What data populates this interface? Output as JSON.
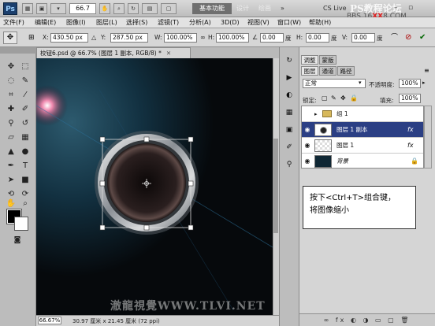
{
  "titlebar": {
    "ps_logo": "Ps",
    "zoom": "66.7",
    "workspace_active": "基本功能",
    "workspace_links": [
      "设计",
      "绘画"
    ],
    "cs_live": "CS Live",
    "watermark_top": "PS教程论坛",
    "watermark_top_url_pre": "BBS.16",
    "watermark_top_url_xx": "XX",
    "watermark_top_url_post": "8.COM"
  },
  "menu": [
    "文件(F)",
    "编辑(E)",
    "图像(I)",
    "图层(L)",
    "选择(S)",
    "滤镜(T)",
    "分析(A)",
    "3D(D)",
    "视图(V)",
    "窗口(W)",
    "帮助(H)"
  ],
  "options": {
    "x_label": "X:",
    "x_value": "430.50 px",
    "y_label": "Y:",
    "y_value": "287.50 px",
    "w_label": "W:",
    "w_value": "100.00%",
    "h_label": "H:",
    "h_value": "100.00%",
    "angle_value": "0.00",
    "angle_unit": "度",
    "h_skew_label": "H:",
    "h_skew_value": "0.00",
    "h_skew_unit": "度",
    "v_label": "V:",
    "v_value": "0.00",
    "v_unit": "度"
  },
  "document": {
    "tab_title": "校钮6.psd @ 66.7% (图层 1 副本, RGB/8) *",
    "status_zoom": "66.67%",
    "status_info": "30.97 厘米 x 21.45 厘米 (72 ppi)"
  },
  "watermark_bottom": "澈龍視覺WWW.TLVI.NET",
  "panel": {
    "top_tabs": [
      "调整",
      "蒙版"
    ],
    "tabs": [
      "图层",
      "通道",
      "路径"
    ],
    "blend_mode": "正常",
    "opacity_label": "不透明度:",
    "opacity_value": "100%",
    "lock_label": "锁定:",
    "fill_label": "填充:",
    "fill_value": "100%",
    "layers": [
      {
        "name": "组 1",
        "fx": ""
      },
      {
        "name": "图层 1 副本",
        "fx": "fx"
      },
      {
        "name": "图层 1",
        "fx": "fx"
      },
      {
        "name": "背景",
        "fx": ""
      }
    ],
    "bottom_icons": "∞ fx ◐ ◑ ▭ ▢ 🗑"
  },
  "callout": {
    "line1": "按下<Ctrl+T>组合键，",
    "line2": "将图像缩小"
  }
}
